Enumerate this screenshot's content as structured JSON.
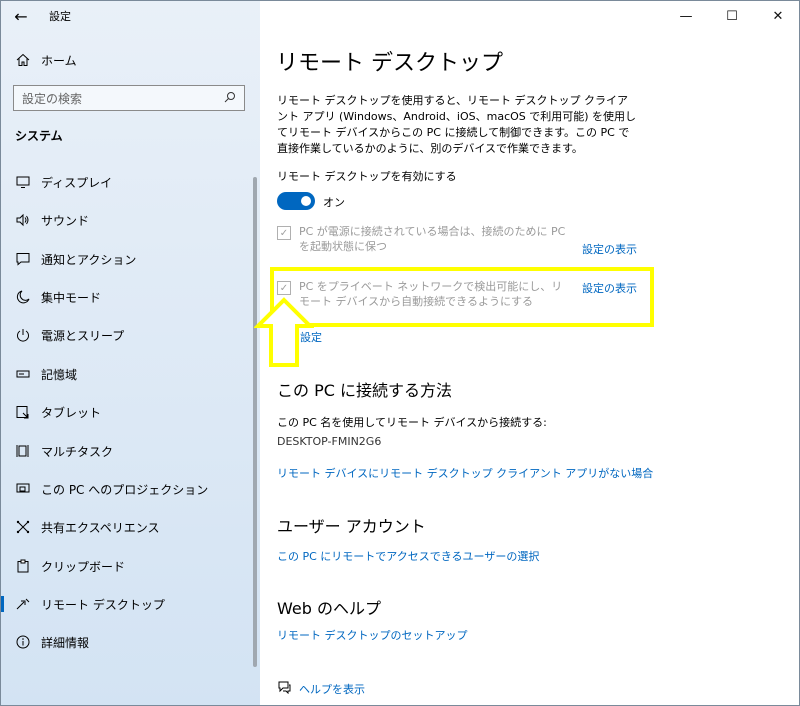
{
  "window": {
    "title": "設定"
  },
  "controls": {
    "back": "←",
    "minimize": "—",
    "maximize": "☐",
    "close": "✕"
  },
  "sidebar": {
    "home": "ホーム",
    "search_placeholder": "設定の検索",
    "section": "システム",
    "items": [
      {
        "label": "ディスプレイ",
        "icon": "display-icon"
      },
      {
        "label": "サウンド",
        "icon": "sound-icon"
      },
      {
        "label": "通知とアクション",
        "icon": "notification-icon"
      },
      {
        "label": "集中モード",
        "icon": "moon-icon"
      },
      {
        "label": "電源とスリープ",
        "icon": "power-icon"
      },
      {
        "label": "記憶域",
        "icon": "storage-icon"
      },
      {
        "label": "タブレット",
        "icon": "tablet-icon"
      },
      {
        "label": "マルチタスク",
        "icon": "multitask-icon"
      },
      {
        "label": "この PC へのプロジェクション",
        "icon": "projection-icon"
      },
      {
        "label": "共有エクスペリエンス",
        "icon": "share-icon"
      },
      {
        "label": "クリップボード",
        "icon": "clipboard-icon"
      },
      {
        "label": "リモート デスクトップ",
        "icon": "remote-icon",
        "active": true
      },
      {
        "label": "詳細情報",
        "icon": "info-icon"
      }
    ]
  },
  "main": {
    "title": "リモート デスクトップ",
    "description": "リモート デスクトップを使用すると、リモート デスクトップ クライアント アプリ (Windows、Android、iOS、macOS で利用可能) を使用してリモート デバイスからこの PC に接続して制御できます。この PC で直接作業しているかのように、別のデバイスで作業できます。",
    "enable_label": "リモート デスクトップを有効にする",
    "toggle_state": "オン",
    "option1": "PC が電源に接続されている場合は、接続のために PC を起動状態に保つ",
    "option1_link": "設定の表示",
    "option2": "PC をプライベート ネットワークで検出可能にし、リモート デバイスから自動接続できるようにする",
    "option2_link": "設定の表示",
    "advanced_link": "設定",
    "connect_heading": "この PC に接続する方法",
    "connect_desc": "この PC 名を使用してリモート デバイスから接続する:",
    "pc_name": "DESKTOP-FMIN2G6",
    "no_client_link": "リモート デバイスにリモート デスクトップ クライアント アプリがない場合",
    "user_heading": "ユーザー アカウント",
    "user_link": "この PC にリモートでアクセスできるユーザーの選択",
    "web_heading": "Web のヘルプ",
    "web_link": "リモート デスクトップのセットアップ",
    "help_link": "ヘルプを表示"
  },
  "colors": {
    "accent": "#0067c0",
    "highlight": "#ffff00"
  }
}
